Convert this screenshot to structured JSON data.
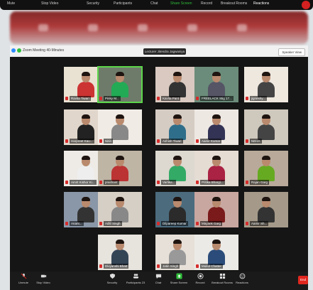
{
  "top_toolbar": {
    "items": [
      "Mute",
      "Stop Video",
      "Security",
      "Participants",
      "Chat",
      "Share Screen",
      "Record",
      "Breakout Rooms",
      "Reactions"
    ]
  },
  "window": {
    "title": "Zoom Meeting 40-Minutes",
    "speaker": "Lecturer Jitendra Jagwaniya Pio",
    "view_button": "Speaker View"
  },
  "participants": [
    {
      "name": "Ravita Tiwari"
    },
    {
      "name": "Pinky M..."
    },
    {
      "name": "Kavita Pant"
    },
    {
      "name": "FREELACK Stig 17..."
    },
    {
      "name": "jigneshy..."
    },
    {
      "name": "Harpreet Kau..."
    },
    {
      "name": "Nitin"
    },
    {
      "name": "Ashish Tiwari"
    },
    {
      "name": "Aamir Kumar"
    },
    {
      "name": "NEHA"
    },
    {
      "name": "Amrit Kishor Ki..."
    },
    {
      "name": "prashant"
    },
    {
      "name": "Vartika..."
    },
    {
      "name": "Pritika Bhargi..."
    },
    {
      "name": "Rajan Garg"
    },
    {
      "name": "Anant..."
    },
    {
      "name": "Aditi Singh"
    },
    {
      "name": "Dilpareep Kumar"
    },
    {
      "name": "Mayank Garg"
    },
    {
      "name": "Aamir Sh..."
    },
    {
      "name": "Divyanshi Bhatt"
    },
    {
      "name": "Jatin Singh"
    },
    {
      "name": "Mukul Chatter"
    }
  ],
  "bottom_toolbar": {
    "unmute": "Unmute",
    "stop_video": "Stop Video",
    "security": "Security",
    "participants": "Participants",
    "participants_count": "23",
    "chat": "Chat",
    "share_screen": "Share Screen",
    "record": "Record",
    "breakout": "Breakout Rooms",
    "reactions": "Reactions",
    "end": "End"
  },
  "colors": {
    "accent_green": "#5cd64a",
    "end_red": "#e0271f",
    "share_green": "#2fbf3a"
  }
}
